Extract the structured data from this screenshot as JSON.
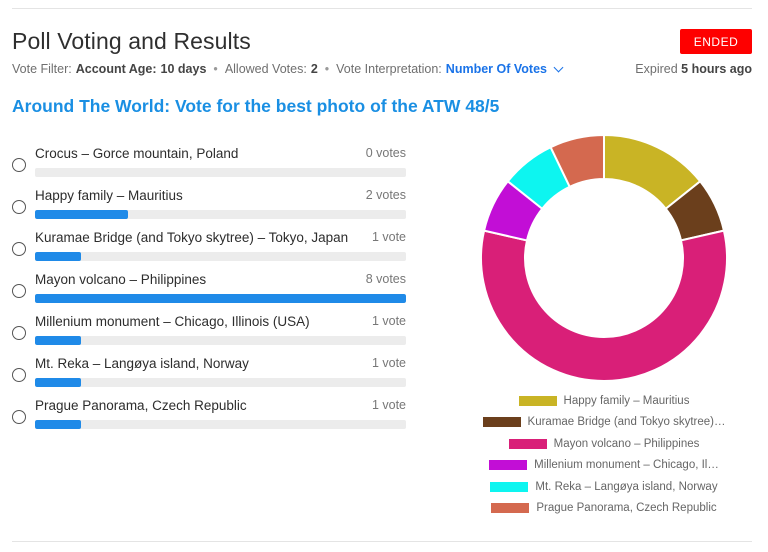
{
  "page": {
    "title": "Poll Voting and Results",
    "status": "ENDED",
    "filter_label": "Vote Filter:",
    "account_age_label": "Account Age:",
    "account_age": "10 days",
    "allowed_label": "Allowed Votes:",
    "allowed": "2",
    "interp_label": "Vote Interpretation:",
    "interp": "Number Of Votes",
    "expired_label": "Expired",
    "expired": "5 hours ago",
    "question": "Around The World: Vote for the best photo of the ATW 48/5"
  },
  "options": [
    {
      "label": "Crocus – Gorce mountain, Poland",
      "votes": 0,
      "votes_text": "0 votes"
    },
    {
      "label": "Happy family – Mauritius",
      "votes": 2,
      "votes_text": "2 votes"
    },
    {
      "label": "Kuramae Bridge (and Tokyo skytree) – Tokyo, Japan",
      "votes": 1,
      "votes_text": "1 vote"
    },
    {
      "label": "Mayon volcano – Philippines",
      "votes": 8,
      "votes_text": "8 votes"
    },
    {
      "label": "Millenium monument – Chicago, Illinois (USA)",
      "votes": 1,
      "votes_text": "1 vote"
    },
    {
      "label": "Mt. Reka – Langøya island, Norway",
      "votes": 1,
      "votes_text": "1 vote"
    },
    {
      "label": "Prague Panorama, Czech Republic",
      "votes": 1,
      "votes_text": "1 vote"
    }
  ],
  "chart_data": {
    "type": "pie",
    "donut": true,
    "legend_position": "bottom",
    "slices": [
      {
        "name": "Happy family – Mauritius",
        "legend": "Happy family – Mauritius",
        "value": 2,
        "color": "#c9b425"
      },
      {
        "name": "Kuramae Bridge (and Tokyo skytree) – Tokyo, Japan",
        "legend": "Kuramae Bridge (and Tokyo skytree)…",
        "value": 1,
        "color": "#6b3f1c"
      },
      {
        "name": "Mayon volcano – Philippines",
        "legend": "Mayon volcano – Philippines",
        "value": 8,
        "color": "#d91f78"
      },
      {
        "name": "Millenium monument – Chicago, Illinois (USA)",
        "legend": "Millenium monument – Chicago, Il…",
        "value": 1,
        "color": "#c20ed6"
      },
      {
        "name": "Mt. Reka – Langøya island, Norway",
        "legend": "Mt. Reka – Langøya island, Norway",
        "value": 1,
        "color": "#0df5f0"
      },
      {
        "name": "Prague Panorama, Czech Republic",
        "legend": "Prague Panorama, Czech Republic",
        "value": 1,
        "color": "#d4694f"
      }
    ]
  }
}
